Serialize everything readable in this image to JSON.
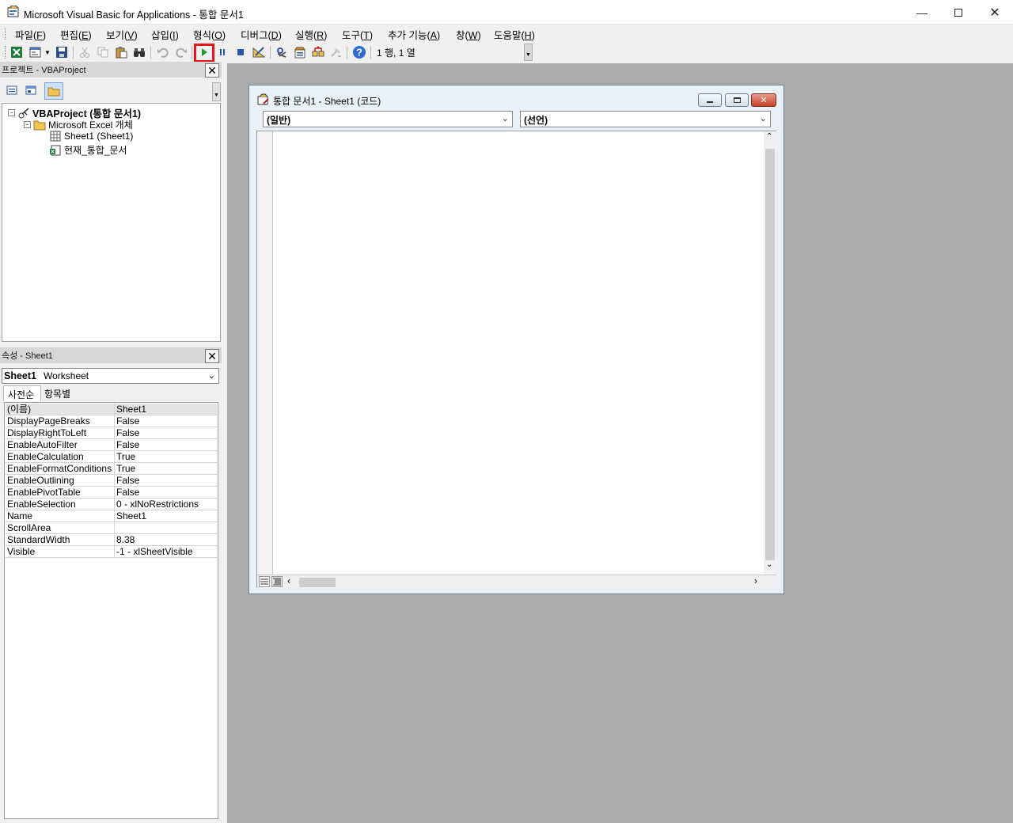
{
  "window": {
    "title": "Microsoft Visual Basic for Applications - 통합 문서1"
  },
  "menu": [
    {
      "label": "파일(",
      "key": "F",
      "end": ")"
    },
    {
      "label": "편집(",
      "key": "E",
      "end": ")"
    },
    {
      "label": "보기(",
      "key": "V",
      "end": ")"
    },
    {
      "label": "삽입(",
      "key": "I",
      "end": ")"
    },
    {
      "label": "형식(",
      "key": "O",
      "end": ")"
    },
    {
      "label": "디버그(",
      "key": "D",
      "end": ")"
    },
    {
      "label": "실행(",
      "key": "R",
      "end": ")"
    },
    {
      "label": "도구(",
      "key": "T",
      "end": ")"
    },
    {
      "label": "추가 기능(",
      "key": "A",
      "end": ")"
    },
    {
      "label": "창(",
      "key": "W",
      "end": ")"
    },
    {
      "label": "도움말(",
      "key": "H",
      "end": ")"
    }
  ],
  "toolbar": {
    "cursor_position": "1 행, 1 열",
    "highlight_color": "#e8141e"
  },
  "project_panel": {
    "title": "프로젝트 - VBAProject",
    "tree": {
      "root": "VBAProject (통합 문서1)",
      "folder": "Microsoft Excel 개체",
      "items": [
        "Sheet1 (Sheet1)",
        "현재_통합_문서"
      ]
    }
  },
  "properties_panel": {
    "title": "속성 - Sheet1",
    "object_name": "Sheet1",
    "object_type": "Worksheet",
    "tabs": [
      "사전순",
      "항목별"
    ],
    "rows": [
      {
        "name": "(이름)",
        "value": "Sheet1"
      },
      {
        "name": "DisplayPageBreaks",
        "value": "False"
      },
      {
        "name": "DisplayRightToLeft",
        "value": "False"
      },
      {
        "name": "EnableAutoFilter",
        "value": "False"
      },
      {
        "name": "EnableCalculation",
        "value": "True"
      },
      {
        "name": "EnableFormatConditions",
        "value": "True"
      },
      {
        "name": "EnableOutlining",
        "value": "False"
      },
      {
        "name": "EnablePivotTable",
        "value": "False"
      },
      {
        "name": "EnableSelection",
        "value": "0 - xlNoRestrictions"
      },
      {
        "name": "Name",
        "value": "Sheet1"
      },
      {
        "name": "ScrollArea",
        "value": ""
      },
      {
        "name": "StandardWidth",
        "value": "8.38"
      },
      {
        "name": "Visible",
        "value": "-1 - xlSheetVisible"
      }
    ]
  },
  "code_window": {
    "title": "통합 문서1 - Sheet1 (코드)",
    "object_combo": "(일반)",
    "procedure_combo": "(선언)"
  }
}
